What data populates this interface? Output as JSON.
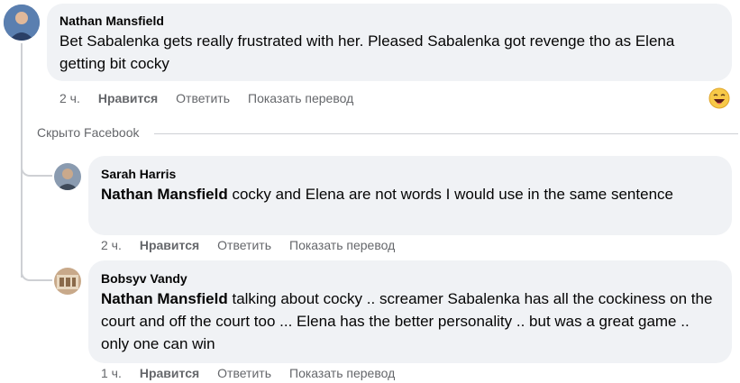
{
  "hidden_label": "Скрыто Facebook",
  "comments": [
    {
      "author": "Nathan Mansfield",
      "mention": "",
      "text": "Bet Sabalenka gets really frustrated with her. Pleased Sabalenka got revenge tho as Elena getting bit cocky",
      "time": "2 ч.",
      "like": "Нравится",
      "reply": "Ответить",
      "translate": "Показать перевод",
      "reaction_icon": "laughing-emoji-icon"
    },
    {
      "author": "Sarah Harris",
      "mention": "Nathan Mansfield",
      "text": " cocky and Elena are not words I would use in the same sentence",
      "time": "2 ч.",
      "like": "Нравится",
      "reply": "Ответить",
      "translate": "Показать перевод"
    },
    {
      "author": "Bobsyv Vandy",
      "mention": "Nathan Mansfield",
      "text": " talking about cocky .. screamer Sabalenka has all the cockiness on the court and off the court too ... Elena has the better personality .. but was a great game .. only one can win",
      "time": "1 ч.",
      "like": "Нравится",
      "reply": "Ответить",
      "translate": "Показать перевод"
    }
  ],
  "colors": {
    "bubble": "#f0f2f5",
    "secondary_text": "#65676b",
    "thread_line": "#ced0d4"
  }
}
